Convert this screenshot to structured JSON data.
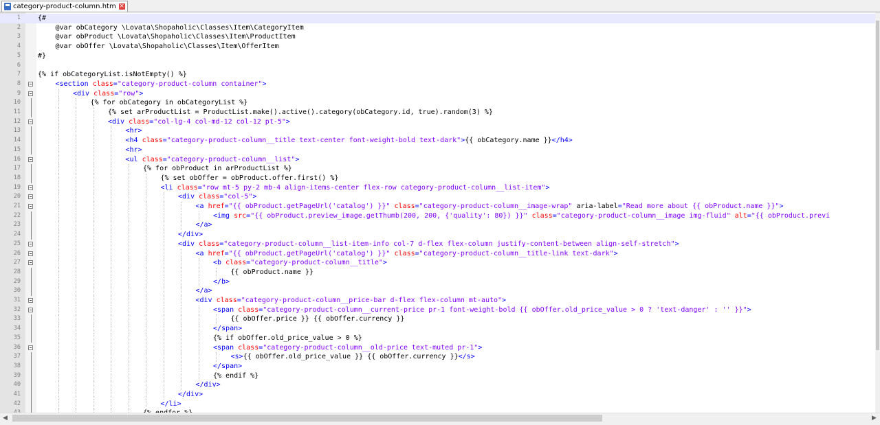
{
  "tab": {
    "label": "category-product-column.htm",
    "icon": "file-icon",
    "close_icon": "close-icon"
  },
  "editor": {
    "current_line": 1,
    "lines": [
      {
        "n": "1",
        "indent": 0,
        "segs": [
          [
            "{#",
            "p"
          ]
        ]
      },
      {
        "n": "2",
        "indent": 1,
        "segs": [
          [
            "@var obCategory \\Lovata\\Shopaholic\\Classes\\Item\\CategoryItem",
            "p"
          ]
        ]
      },
      {
        "n": "3",
        "indent": 1,
        "segs": [
          [
            "@var obProduct \\Lovata\\Shopaholic\\Classes\\Item\\ProductItem",
            "p"
          ]
        ]
      },
      {
        "n": "4",
        "indent": 1,
        "segs": [
          [
            "@var obOffer \\Lovata\\Shopaholic\\Classes\\Item\\OfferItem",
            "p"
          ]
        ]
      },
      {
        "n": "5",
        "indent": 0,
        "segs": [
          [
            "#}",
            "p"
          ]
        ]
      },
      {
        "n": "6",
        "indent": 0,
        "segs": []
      },
      {
        "n": "7",
        "indent": 0,
        "segs": [
          [
            "{% if obCategoryList.isNotEmpty() %}",
            "p"
          ]
        ]
      },
      {
        "n": "8",
        "indent": 1,
        "segs": [
          [
            "<section ",
            "t"
          ],
          [
            "class",
            "a"
          ],
          [
            "=",
            "t"
          ],
          [
            "\"category-product-column container\"",
            "v"
          ],
          [
            ">",
            "t"
          ]
        ]
      },
      {
        "n": "9",
        "indent": 2,
        "segs": [
          [
            "<div ",
            "t"
          ],
          [
            "class",
            "a"
          ],
          [
            "=",
            "t"
          ],
          [
            "\"row\"",
            "v"
          ],
          [
            ">",
            "t"
          ]
        ]
      },
      {
        "n": "10",
        "indent": 3,
        "segs": [
          [
            "{% for obCategory in obCategoryList %}",
            "p"
          ]
        ]
      },
      {
        "n": "11",
        "indent": 4,
        "segs": [
          [
            "{% set arProductList = ProductList.make().active().category(obCategory.id, true).random(3) %}",
            "p"
          ]
        ]
      },
      {
        "n": "12",
        "indent": 4,
        "segs": [
          [
            "<div ",
            "t"
          ],
          [
            "class",
            "a"
          ],
          [
            "=",
            "t"
          ],
          [
            "\"col-lg-4 col-md-12 col-12 pt-5\"",
            "v"
          ],
          [
            ">",
            "t"
          ]
        ]
      },
      {
        "n": "13",
        "indent": 5,
        "segs": [
          [
            "<hr>",
            "t"
          ]
        ]
      },
      {
        "n": "14",
        "indent": 5,
        "segs": [
          [
            "<h4 ",
            "t"
          ],
          [
            "class",
            "a"
          ],
          [
            "=",
            "t"
          ],
          [
            "\"category-product-column__title text-center font-weight-bold text-dark\"",
            "v"
          ],
          [
            ">",
            "t"
          ],
          [
            "{{ obCategory.name }}",
            "p"
          ],
          [
            "</h4>",
            "t"
          ]
        ]
      },
      {
        "n": "15",
        "indent": 5,
        "segs": [
          [
            "<hr>",
            "t"
          ]
        ]
      },
      {
        "n": "16",
        "indent": 5,
        "segs": [
          [
            "<ul ",
            "t"
          ],
          [
            "class",
            "a"
          ],
          [
            "=",
            "t"
          ],
          [
            "\"category-product-column__list\"",
            "v"
          ],
          [
            ">",
            "t"
          ]
        ]
      },
      {
        "n": "17",
        "indent": 6,
        "segs": [
          [
            "{% for obProduct in arProductList %}",
            "p"
          ]
        ]
      },
      {
        "n": "18",
        "indent": 7,
        "segs": [
          [
            "{% set obOffer = obProduct.offer.first() %}",
            "p"
          ]
        ]
      },
      {
        "n": "19",
        "indent": 7,
        "segs": [
          [
            "<li ",
            "t"
          ],
          [
            "class",
            "a"
          ],
          [
            "=",
            "t"
          ],
          [
            "\"row mt-5 py-2 mb-4 align-items-center flex-row category-product-column__list-item\"",
            "v"
          ],
          [
            ">",
            "t"
          ]
        ]
      },
      {
        "n": "20",
        "indent": 8,
        "segs": [
          [
            "<div ",
            "t"
          ],
          [
            "class",
            "a"
          ],
          [
            "=",
            "t"
          ],
          [
            "\"col-5\"",
            "v"
          ],
          [
            ">",
            "t"
          ]
        ]
      },
      {
        "n": "21",
        "indent": 9,
        "segs": [
          [
            "<a ",
            "t"
          ],
          [
            "href",
            "a"
          ],
          [
            "=",
            "t"
          ],
          [
            "\"{{ obProduct.getPageUrl('catalog') }}\"",
            "v"
          ],
          [
            " ",
            "t"
          ],
          [
            "class",
            "a"
          ],
          [
            "=",
            "t"
          ],
          [
            "\"category-product-column__image-wrap\"",
            "v"
          ],
          [
            " ",
            "t"
          ],
          [
            "aria-label",
            "p"
          ],
          [
            "=",
            "t"
          ],
          [
            "\"Read more about {{ obProduct.name }}\"",
            "v"
          ],
          [
            ">",
            "t"
          ]
        ]
      },
      {
        "n": "22",
        "indent": 10,
        "segs": [
          [
            "<img ",
            "t"
          ],
          [
            "src",
            "a"
          ],
          [
            "=",
            "t"
          ],
          [
            "\"{{ obProduct.preview_image.getThumb(200, 200, {'quality': 80}) }}\"",
            "v"
          ],
          [
            " ",
            "t"
          ],
          [
            "class",
            "a"
          ],
          [
            "=",
            "t"
          ],
          [
            "\"category-product-column__image img-fluid\"",
            "v"
          ],
          [
            " ",
            "t"
          ],
          [
            "alt",
            "a"
          ],
          [
            "=",
            "t"
          ],
          [
            "\"{{ obProduct.previ",
            "v"
          ]
        ]
      },
      {
        "n": "23",
        "indent": 9,
        "segs": [
          [
            "</a>",
            "t"
          ]
        ]
      },
      {
        "n": "24",
        "indent": 8,
        "segs": [
          [
            "</div>",
            "t"
          ]
        ]
      },
      {
        "n": "25",
        "indent": 8,
        "segs": [
          [
            "<div ",
            "t"
          ],
          [
            "class",
            "a"
          ],
          [
            "=",
            "t"
          ],
          [
            "\"category-product-column__list-item-info col-7 d-flex flex-column justify-content-between align-self-stretch\"",
            "v"
          ],
          [
            ">",
            "t"
          ]
        ]
      },
      {
        "n": "26",
        "indent": 9,
        "segs": [
          [
            "<a ",
            "t"
          ],
          [
            "href",
            "a"
          ],
          [
            "=",
            "t"
          ],
          [
            "\"{{ obProduct.getPageUrl('catalog') }}\"",
            "v"
          ],
          [
            " ",
            "t"
          ],
          [
            "class",
            "a"
          ],
          [
            "=",
            "t"
          ],
          [
            "\"category-product-column__title-link text-dark\"",
            "v"
          ],
          [
            ">",
            "t"
          ]
        ]
      },
      {
        "n": "27",
        "indent": 10,
        "segs": [
          [
            "<b ",
            "t"
          ],
          [
            "class",
            "a"
          ],
          [
            "=",
            "t"
          ],
          [
            "\"category-product-column__title\"",
            "v"
          ],
          [
            ">",
            "t"
          ]
        ]
      },
      {
        "n": "28",
        "indent": 11,
        "segs": [
          [
            "{{ obProduct.name }}",
            "p"
          ]
        ]
      },
      {
        "n": "29",
        "indent": 10,
        "segs": [
          [
            "</b>",
            "t"
          ]
        ]
      },
      {
        "n": "30",
        "indent": 9,
        "segs": [
          [
            "</a>",
            "t"
          ]
        ]
      },
      {
        "n": "31",
        "indent": 9,
        "segs": [
          [
            "<div ",
            "t"
          ],
          [
            "class",
            "a"
          ],
          [
            "=",
            "t"
          ],
          [
            "\"category-product-column__price-bar d-flex flex-column mt-auto\"",
            "v"
          ],
          [
            ">",
            "t"
          ]
        ]
      },
      {
        "n": "32",
        "indent": 10,
        "segs": [
          [
            "<span ",
            "t"
          ],
          [
            "class",
            "a"
          ],
          [
            "=",
            "t"
          ],
          [
            "\"category-product-column__current-price pr-1 font-weight-bold {{ obOffer.old_price_value > 0 ? 'text-danger' : '' }}\"",
            "v"
          ],
          [
            ">",
            "t"
          ]
        ]
      },
      {
        "n": "33",
        "indent": 11,
        "segs": [
          [
            "{{ obOffer.price }} {{ obOffer.currency }}",
            "p"
          ]
        ]
      },
      {
        "n": "34",
        "indent": 10,
        "segs": [
          [
            "</span>",
            "t"
          ]
        ]
      },
      {
        "n": "35",
        "indent": 10,
        "segs": [
          [
            "{% if obOffer.old_price_value > 0 %}",
            "p"
          ]
        ]
      },
      {
        "n": "36",
        "indent": 10,
        "segs": [
          [
            "<span ",
            "t"
          ],
          [
            "class",
            "a"
          ],
          [
            "=",
            "t"
          ],
          [
            "\"category-product-column__old-price text-muted pr-1\"",
            "v"
          ],
          [
            ">",
            "t"
          ]
        ]
      },
      {
        "n": "37",
        "indent": 11,
        "segs": [
          [
            "<s>",
            "t"
          ],
          [
            "{{ obOffer.old_price_value }} {{ obOffer.currency }}",
            "p"
          ],
          [
            "</s>",
            "t"
          ]
        ]
      },
      {
        "n": "38",
        "indent": 10,
        "segs": [
          [
            "</span>",
            "t"
          ]
        ]
      },
      {
        "n": "39",
        "indent": 10,
        "segs": [
          [
            "{% endif %}",
            "p"
          ]
        ]
      },
      {
        "n": "40",
        "indent": 9,
        "segs": [
          [
            "</div>",
            "t"
          ]
        ]
      },
      {
        "n": "41",
        "indent": 8,
        "segs": [
          [
            "</div>",
            "t"
          ]
        ]
      },
      {
        "n": "42",
        "indent": 7,
        "segs": [
          [
            "</li>",
            "t"
          ]
        ]
      },
      {
        "n": "43",
        "indent": 6,
        "segs": [
          [
            "{% endfor %}",
            "p"
          ]
        ]
      }
    ],
    "fold_markers": [
      "8",
      "9",
      "12",
      "16",
      "19",
      "20",
      "21",
      "25",
      "26",
      "27",
      "31",
      "32",
      "36"
    ]
  },
  "colors": {
    "tag": "#0000ff",
    "attribute": "#ff0000",
    "string": "#8000ff",
    "text": "#000000",
    "current_line": "#e8e8ff"
  }
}
